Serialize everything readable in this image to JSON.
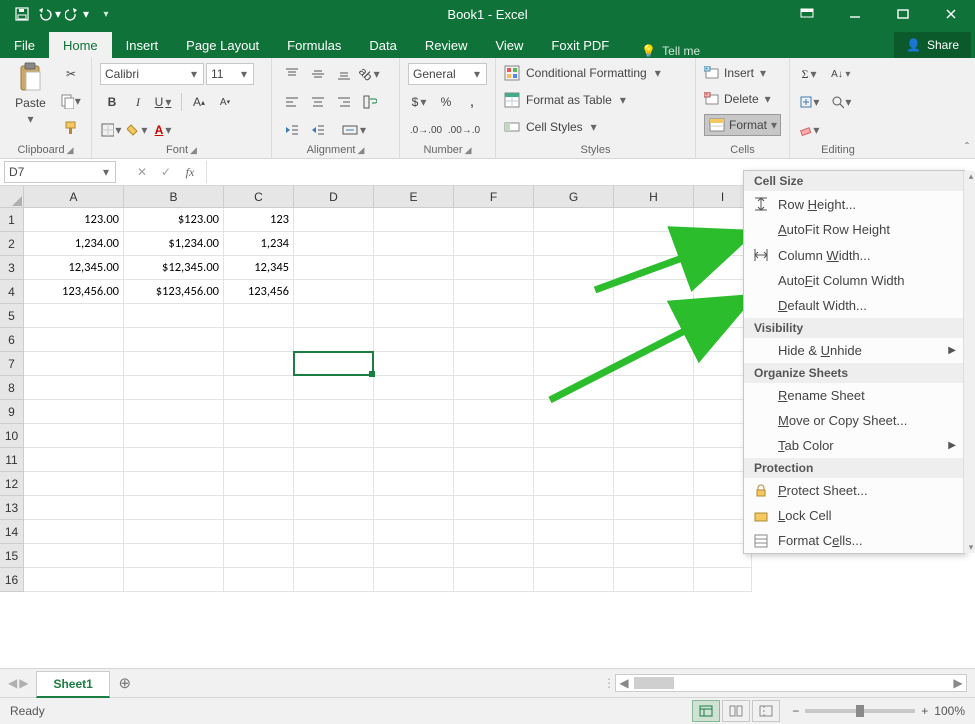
{
  "title_bar": {
    "title": "Book1 - Excel"
  },
  "tabs": {
    "file": "File",
    "home": "Home",
    "insert": "Insert",
    "page_layout": "Page Layout",
    "formulas": "Formulas",
    "data": "Data",
    "review": "Review",
    "view": "View",
    "foxit": "Foxit PDF",
    "tell_me": "Tell me",
    "share": "Share"
  },
  "ribbon": {
    "clipboard": {
      "label": "Clipboard",
      "paste": "Paste"
    },
    "font": {
      "label": "Font",
      "family": "Calibri",
      "size": "11",
      "bold": "B",
      "italic": "I",
      "underline": "U"
    },
    "alignment": {
      "label": "Alignment"
    },
    "number": {
      "label": "Number",
      "format": "General"
    },
    "styles": {
      "label": "Styles",
      "conditional": "Conditional Formatting",
      "table": "Format as Table",
      "cell": "Cell Styles"
    },
    "cells": {
      "label": "Cells",
      "insert": "Insert",
      "delete": "Delete",
      "format": "Format"
    },
    "editing": {
      "label": "Editing"
    }
  },
  "formula_bar": {
    "name_box": "D7",
    "formula": ""
  },
  "grid": {
    "col_widths": {
      "A": 100,
      "B": 100,
      "C": 70,
      "D": 80,
      "E": 80,
      "F": 80,
      "G": 80,
      "H": 80,
      "I": 58
    },
    "columns": [
      "A",
      "B",
      "C",
      "D",
      "E",
      "F",
      "G",
      "H",
      "I"
    ],
    "rows_shown": 16,
    "data": [
      {
        "A": "123.00",
        "B": "$123.00",
        "C": "123"
      },
      {
        "A": "1,234.00",
        "B": "$1,234.00",
        "C": "1,234"
      },
      {
        "A": "12,345.00",
        "B": "$12,345.00",
        "C": "12,345"
      },
      {
        "A": "123,456.00",
        "B": "$123,456.00",
        "C": "123,456"
      }
    ],
    "selected": {
      "row": 7,
      "col": "D"
    }
  },
  "format_menu": {
    "cell_size_hdr": "Cell Size",
    "row_height": "Row Height...",
    "autofit_row": "AutoFit Row Height",
    "col_width": "Column Width...",
    "autofit_col": "AutoFit Column Width",
    "default_width": "Default Width...",
    "visibility_hdr": "Visibility",
    "hide_unhide": "Hide & Unhide",
    "organize_hdr": "Organize Sheets",
    "rename": "Rename Sheet",
    "move_copy": "Move or Copy Sheet...",
    "tab_color": "Tab Color",
    "protection_hdr": "Protection",
    "protect": "Protect Sheet...",
    "lock": "Lock Cell",
    "format_cells": "Format Cells..."
  },
  "sheets": {
    "active": "Sheet1"
  },
  "status": {
    "ready": "Ready",
    "zoom": "100%"
  }
}
